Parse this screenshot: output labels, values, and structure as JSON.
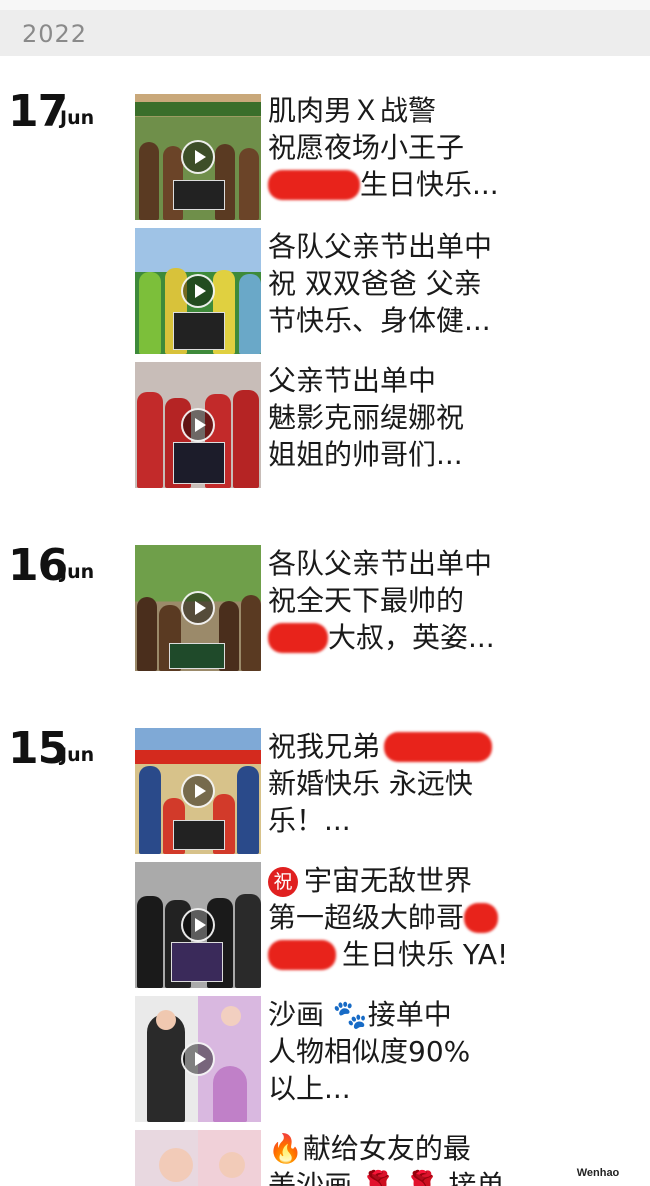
{
  "year": "2022",
  "groups": [
    {
      "day": "17",
      "month": "Jun",
      "posts": [
        {
          "lines": [
            "肌肉男Ｘ战警",
            "祝愿夜场小王子",
            "生日快乐..."
          ]
        },
        {
          "lines": [
            "各队父亲节出单中",
            "祝 双双爸爸 父亲",
            "节快乐、身体健..."
          ]
        },
        {
          "lines": [
            "父亲节出单中",
            "魅影克丽缇娜祝",
            "姐姐的帅哥们..."
          ]
        }
      ]
    },
    {
      "day": "16",
      "month": "Jun",
      "posts": [
        {
          "lines": [
            "各队父亲节出单中",
            "祝全天下最帅的",
            "大叔，英姿..."
          ]
        }
      ]
    },
    {
      "day": "15",
      "month": "Jun",
      "posts": [
        {
          "lines": [
            "祝我兄弟",
            "新婚快乐  永远快",
            "乐！..."
          ]
        },
        {
          "lines": [
            "宇宙无敌世界",
            "第一超级大帥哥",
            "生日快乐 YA!"
          ],
          "badge": "祝"
        },
        {
          "lines": [
            "沙画",
            "接单中",
            "人物相似度90%",
            "以上..."
          ]
        },
        {
          "lines": [
            "献给女友的最",
            "美沙画",
            "接单"
          ]
        }
      ]
    }
  ],
  "credit": "Wenhao (Screenshot)",
  "colors": {
    "redaction": "#e8231b",
    "badge": "#e02020",
    "year_bar": "#ededed"
  }
}
